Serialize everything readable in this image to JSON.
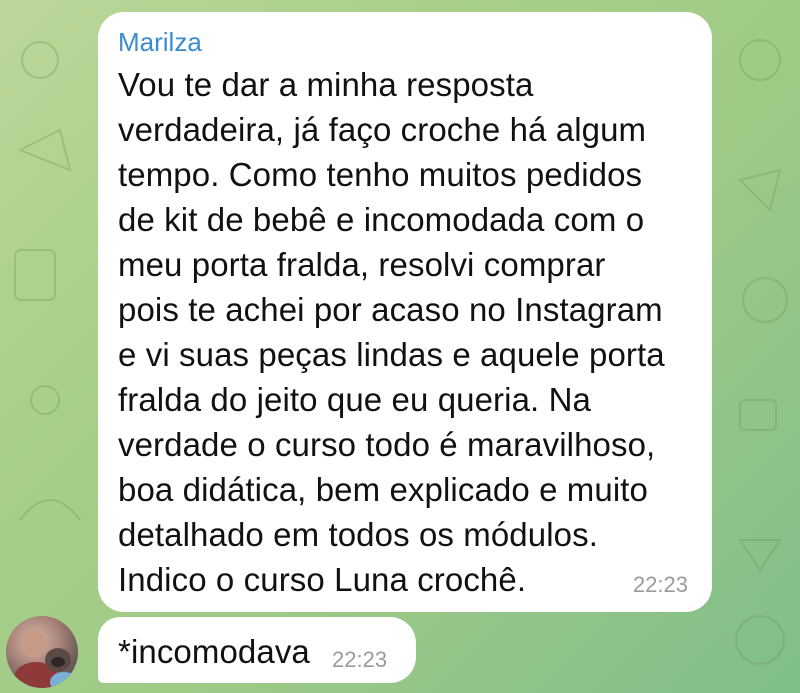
{
  "messages": [
    {
      "sender": "Marilza",
      "text": "Vou te dar a minha resposta\nverdadeira, já faço croche há algum\ntempo. Como tenho muitos pedidos\nde kit de bebê e incomodada com o\nmeu porta fralda, resolvi comprar\npois te achei por acaso no Instagram\ne vi suas peças lindas e aquele porta\nfralda do jeito que eu queria. Na\nverdade o curso todo é maravilhoso,\nboa didática, bem explicado e muito\ndetalhado em todos os módulos.\nIndico o curso Luna crochê.",
      "time": "22:23"
    },
    {
      "text": "*incomodava",
      "time": "22:23"
    }
  ],
  "colors": {
    "sender_name": "#3a8bd0",
    "bubble": "#ffffff",
    "timestamp": "#9a9a9a",
    "wallpaper_start": "#bcd79a",
    "wallpaper_end": "#7fbe8a"
  },
  "icons": [
    "sender-avatar"
  ]
}
